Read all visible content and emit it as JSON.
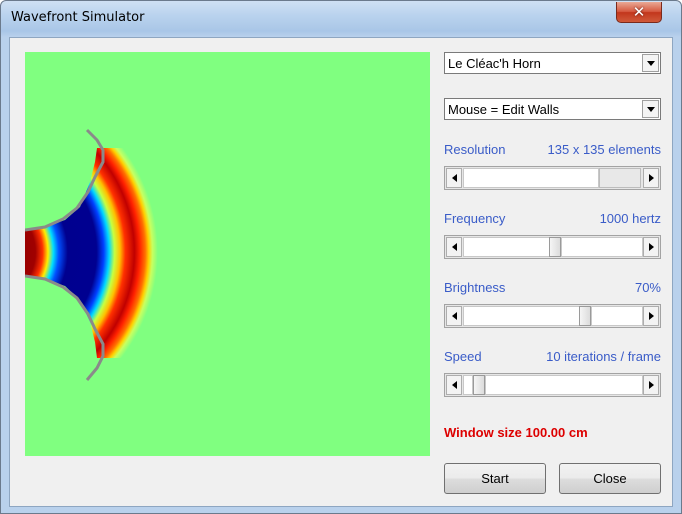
{
  "window": {
    "title": "Wavefront Simulator",
    "close_glyph": "✕"
  },
  "controls": {
    "preset": "Le Cléac'h Horn",
    "mouse_mode": "Mouse = Edit Walls",
    "resolution": {
      "label": "Resolution",
      "value": "135 x 135 elements",
      "level": 0.8
    },
    "frequency": {
      "label": "Frequency",
      "value": "1000 hertz",
      "level": 0.5
    },
    "brightness": {
      "label": "Brightness",
      "value": "70%",
      "level": 0.7
    },
    "speed": {
      "label": "Speed",
      "value": "10 iterations / frame",
      "level": 0.05
    }
  },
  "status": "Window size 100.00 cm",
  "buttons": {
    "start": "Start",
    "close": "Close"
  },
  "colors": {
    "background_field": "#80ff80",
    "label_blue": "#3a5cc8",
    "status_red": "#dd0000",
    "wall": "#8a8a8a"
  },
  "icons": [
    "close-icon",
    "dropdown-arrow-icon",
    "scroll-left-icon",
    "scroll-right-icon"
  ]
}
